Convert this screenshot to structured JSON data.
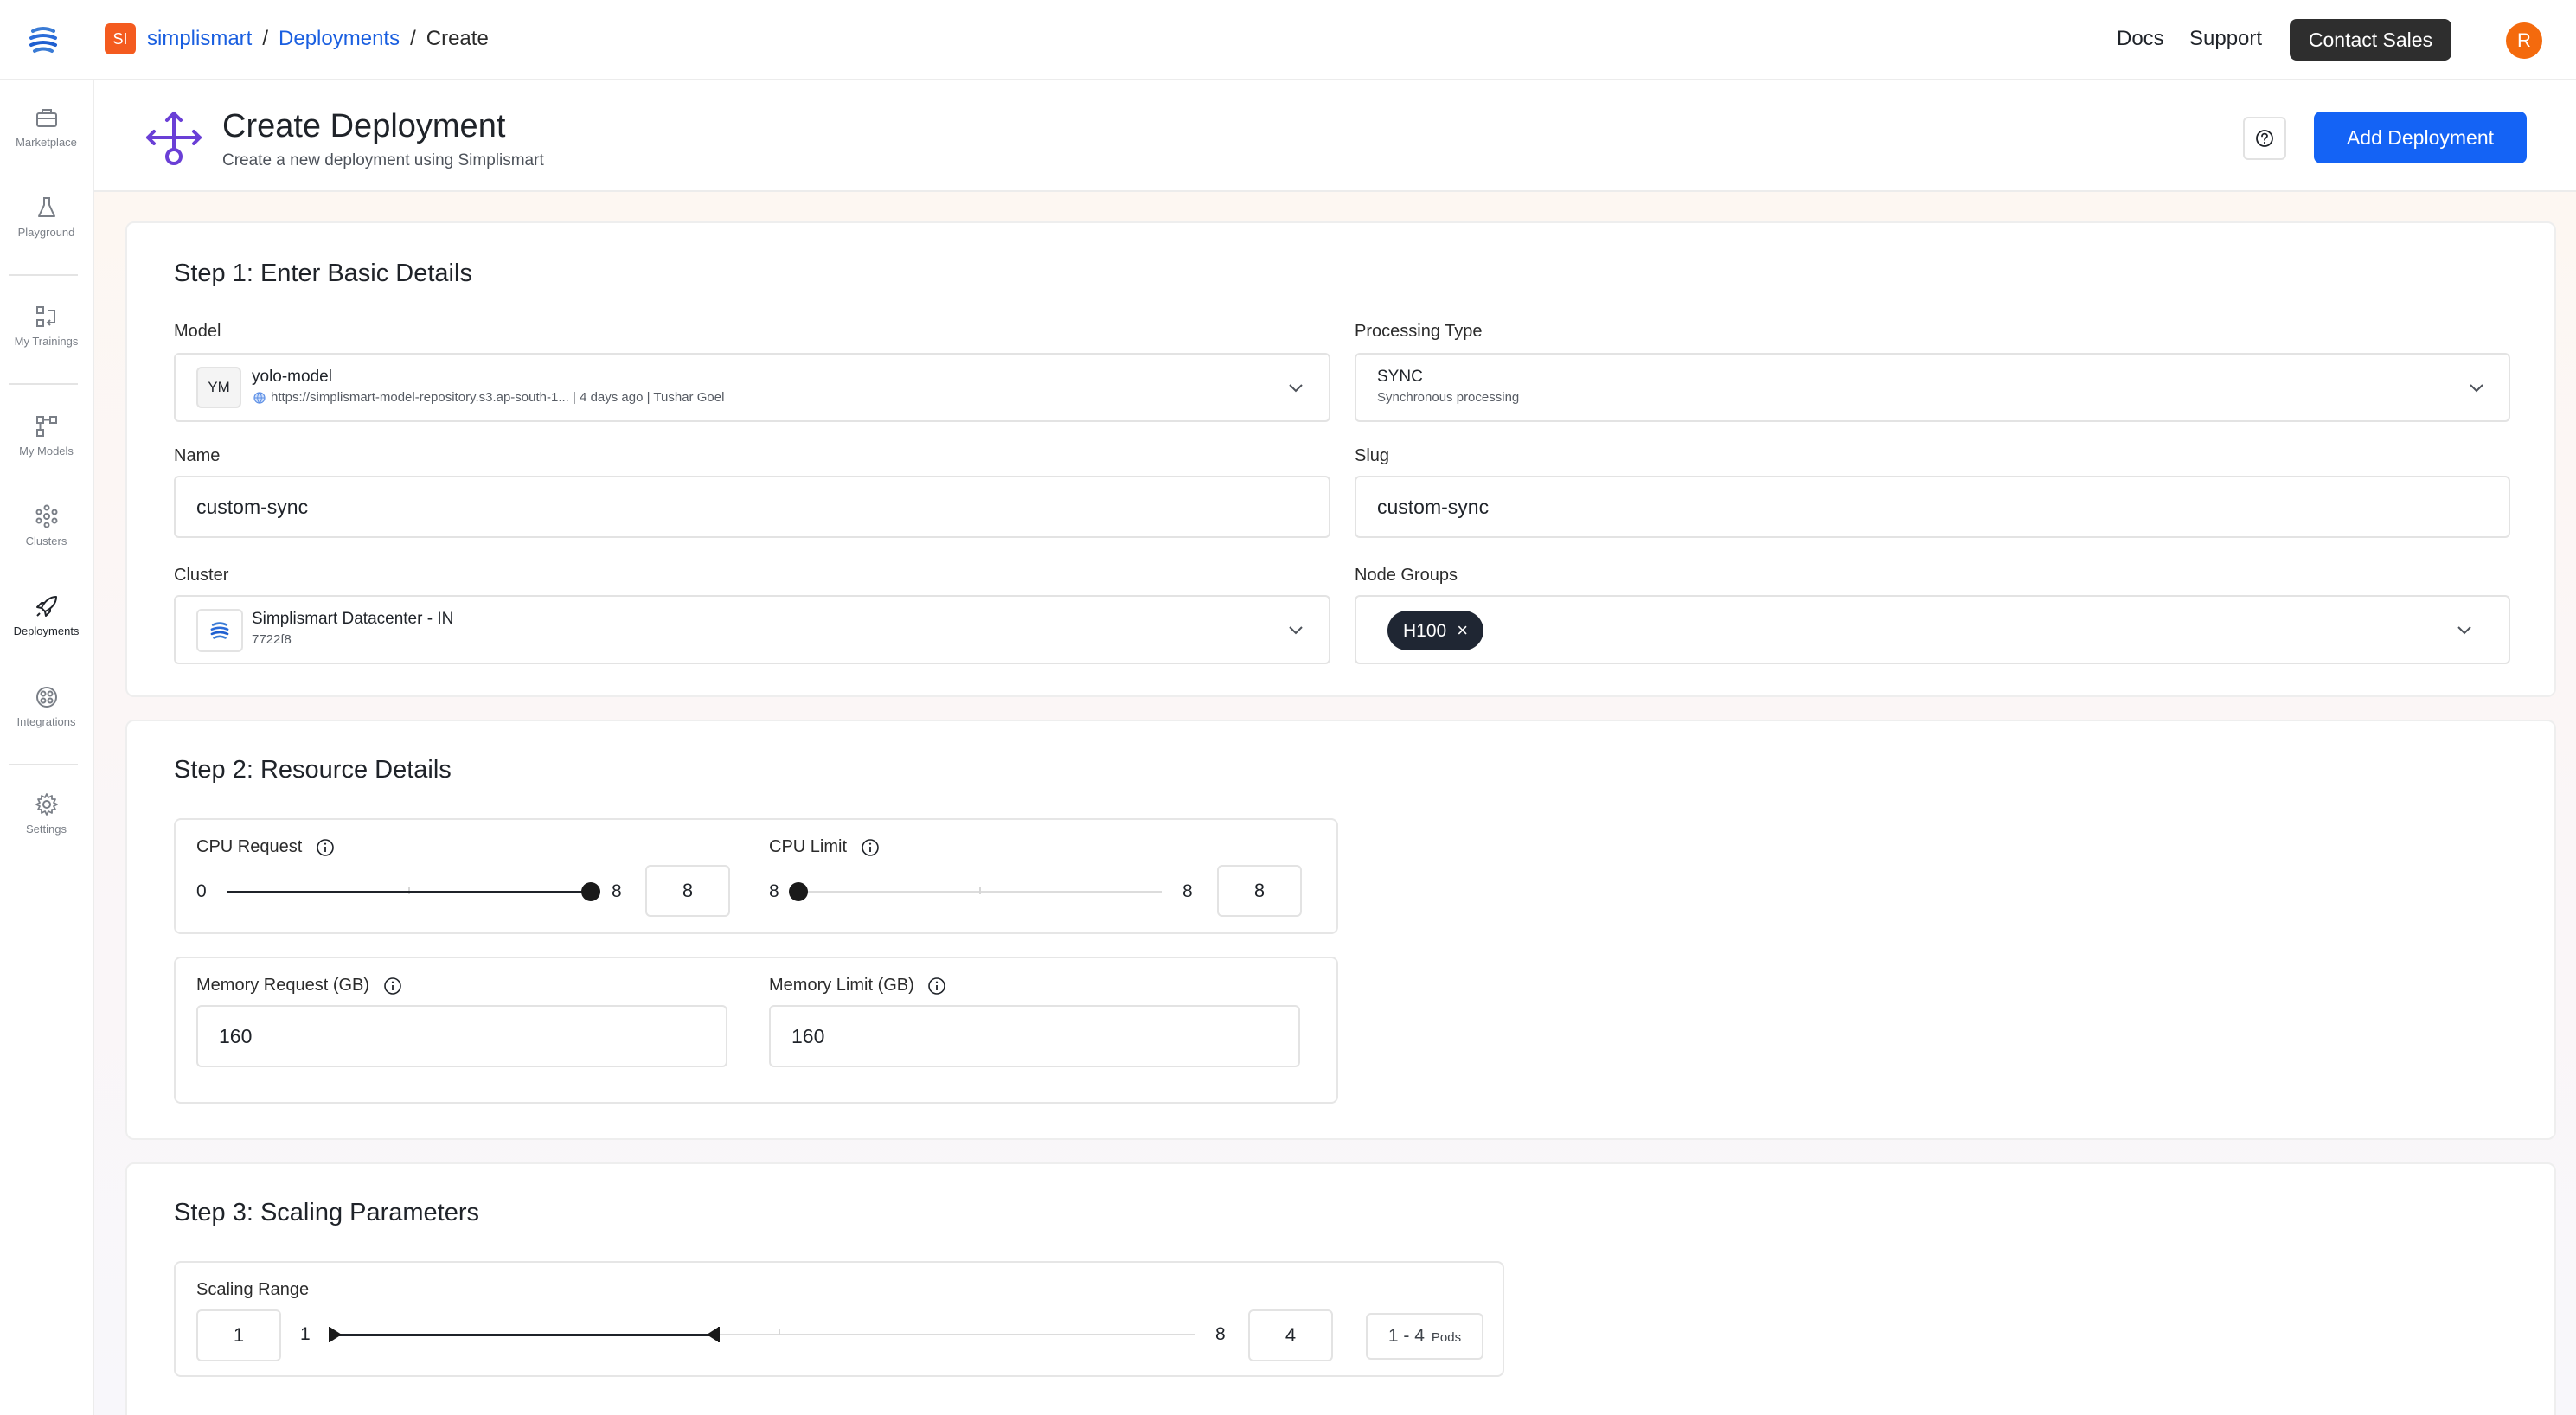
{
  "topbar": {
    "org_initials": "SI",
    "breadcrumb": {
      "org": "simplismart",
      "section": "Deployments",
      "current": "Create"
    },
    "docs": "Docs",
    "support": "Support",
    "contact_sales": "Contact Sales",
    "avatar_initial": "R"
  },
  "sidebar": {
    "items": [
      {
        "label": "Marketplace",
        "icon": "marketplace-icon"
      },
      {
        "label": "Playground",
        "icon": "flask-icon"
      },
      {
        "label": "My Trainings",
        "icon": "trainings-icon"
      },
      {
        "label": "My Models",
        "icon": "models-icon"
      },
      {
        "label": "Clusters",
        "icon": "clusters-icon"
      },
      {
        "label": "Deployments",
        "icon": "rocket-icon",
        "active": true
      },
      {
        "label": "Integrations",
        "icon": "integrations-icon"
      },
      {
        "label": "Settings",
        "icon": "gear-icon"
      }
    ]
  },
  "header": {
    "title": "Create Deployment",
    "subtitle": "Create a new deployment using Simplismart",
    "add_button": "Add Deployment"
  },
  "step1": {
    "title": "Step 1: Enter Basic Details",
    "model": {
      "label": "Model",
      "badge": "YM",
      "name": "yolo-model",
      "meta": "https://simplismart-model-repository.s3.ap-south-1... | 4 days ago | Tushar Goel"
    },
    "processing": {
      "label": "Processing Type",
      "value": "SYNC",
      "description": "Synchronous processing"
    },
    "name": {
      "label": "Name",
      "value": "custom-sync"
    },
    "slug": {
      "label": "Slug",
      "value": "custom-sync"
    },
    "cluster": {
      "label": "Cluster",
      "name": "Simplismart Datacenter - IN",
      "id": "7722f8"
    },
    "node_groups": {
      "label": "Node Groups",
      "chips": [
        "H100"
      ]
    }
  },
  "step2": {
    "title": "Step 2: Resource Details",
    "cpu_request": {
      "label": "CPU Request",
      "min": "0",
      "max": "8",
      "value": "8",
      "fraction": 1.0
    },
    "cpu_limit": {
      "label": "CPU Limit",
      "min": "8",
      "max": "8",
      "value": "8",
      "fraction": 0.0
    },
    "memory_request": {
      "label": "Memory Request (GB)",
      "value": "160"
    },
    "memory_limit": {
      "label": "Memory Limit (GB)",
      "value": "160"
    }
  },
  "step3": {
    "title": "Step 3: Scaling Parameters",
    "scaling": {
      "label": "Scaling Range",
      "min_input": "1",
      "min": "1",
      "max": "8",
      "max_input": "4",
      "range_text": "1 - 4",
      "unit": "Pods",
      "range_fraction": [
        0.0,
        0.45
      ]
    }
  },
  "colors": {
    "accent": "#1463f5",
    "brand_orange": "#f45b1f",
    "icon_purple": "#6a3fd6",
    "chip_dark": "#1f2633"
  }
}
